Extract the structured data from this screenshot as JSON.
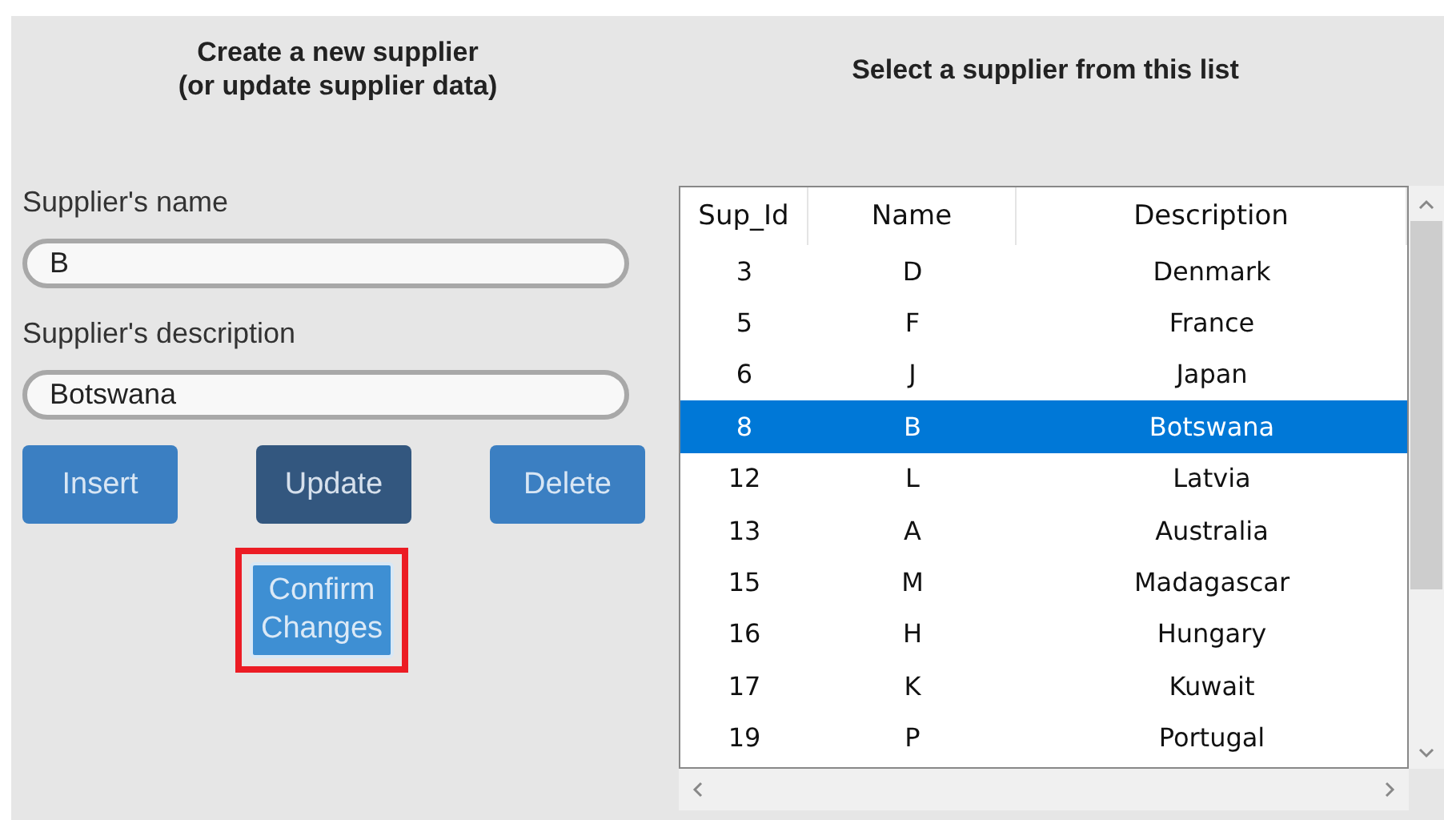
{
  "form": {
    "title_lines": [
      "Create a new supplier",
      "(or update supplier data)"
    ],
    "fields": [
      {
        "label": "Supplier's name",
        "value": "B"
      },
      {
        "label": "Supplier's description",
        "value": "Botswana"
      }
    ],
    "buttons": [
      {
        "label": "Insert",
        "active": false
      },
      {
        "label": "Update",
        "active": true
      },
      {
        "label": "Delete",
        "active": false
      }
    ],
    "confirm_button": {
      "label_lines": [
        "Confirm",
        "Changes"
      ],
      "highlighted": true
    }
  },
  "list": {
    "title": "Select a supplier from this list",
    "table": {
      "columns": [
        "Sup_Id",
        "Name",
        "Description"
      ],
      "rows": [
        {
          "cells": [
            "3",
            "D",
            "Denmark"
          ],
          "selected": false
        },
        {
          "cells": [
            "5",
            "F",
            "France"
          ],
          "selected": false
        },
        {
          "cells": [
            "6",
            "J",
            "Japan"
          ],
          "selected": false
        },
        {
          "cells": [
            "8",
            "B",
            "Botswana"
          ],
          "selected": true
        },
        {
          "cells": [
            "12",
            "L",
            "Latvia"
          ],
          "selected": false
        },
        {
          "cells": [
            "13",
            "A",
            "Australia"
          ],
          "selected": false
        },
        {
          "cells": [
            "15",
            "M",
            "Madagascar"
          ],
          "selected": false
        },
        {
          "cells": [
            "16",
            "H",
            "Hungary"
          ],
          "selected": false
        },
        {
          "cells": [
            "17",
            "K",
            "Kuwait"
          ],
          "selected": false
        },
        {
          "cells": [
            "19",
            "P",
            "Portugal"
          ],
          "selected": false
        }
      ]
    }
  }
}
